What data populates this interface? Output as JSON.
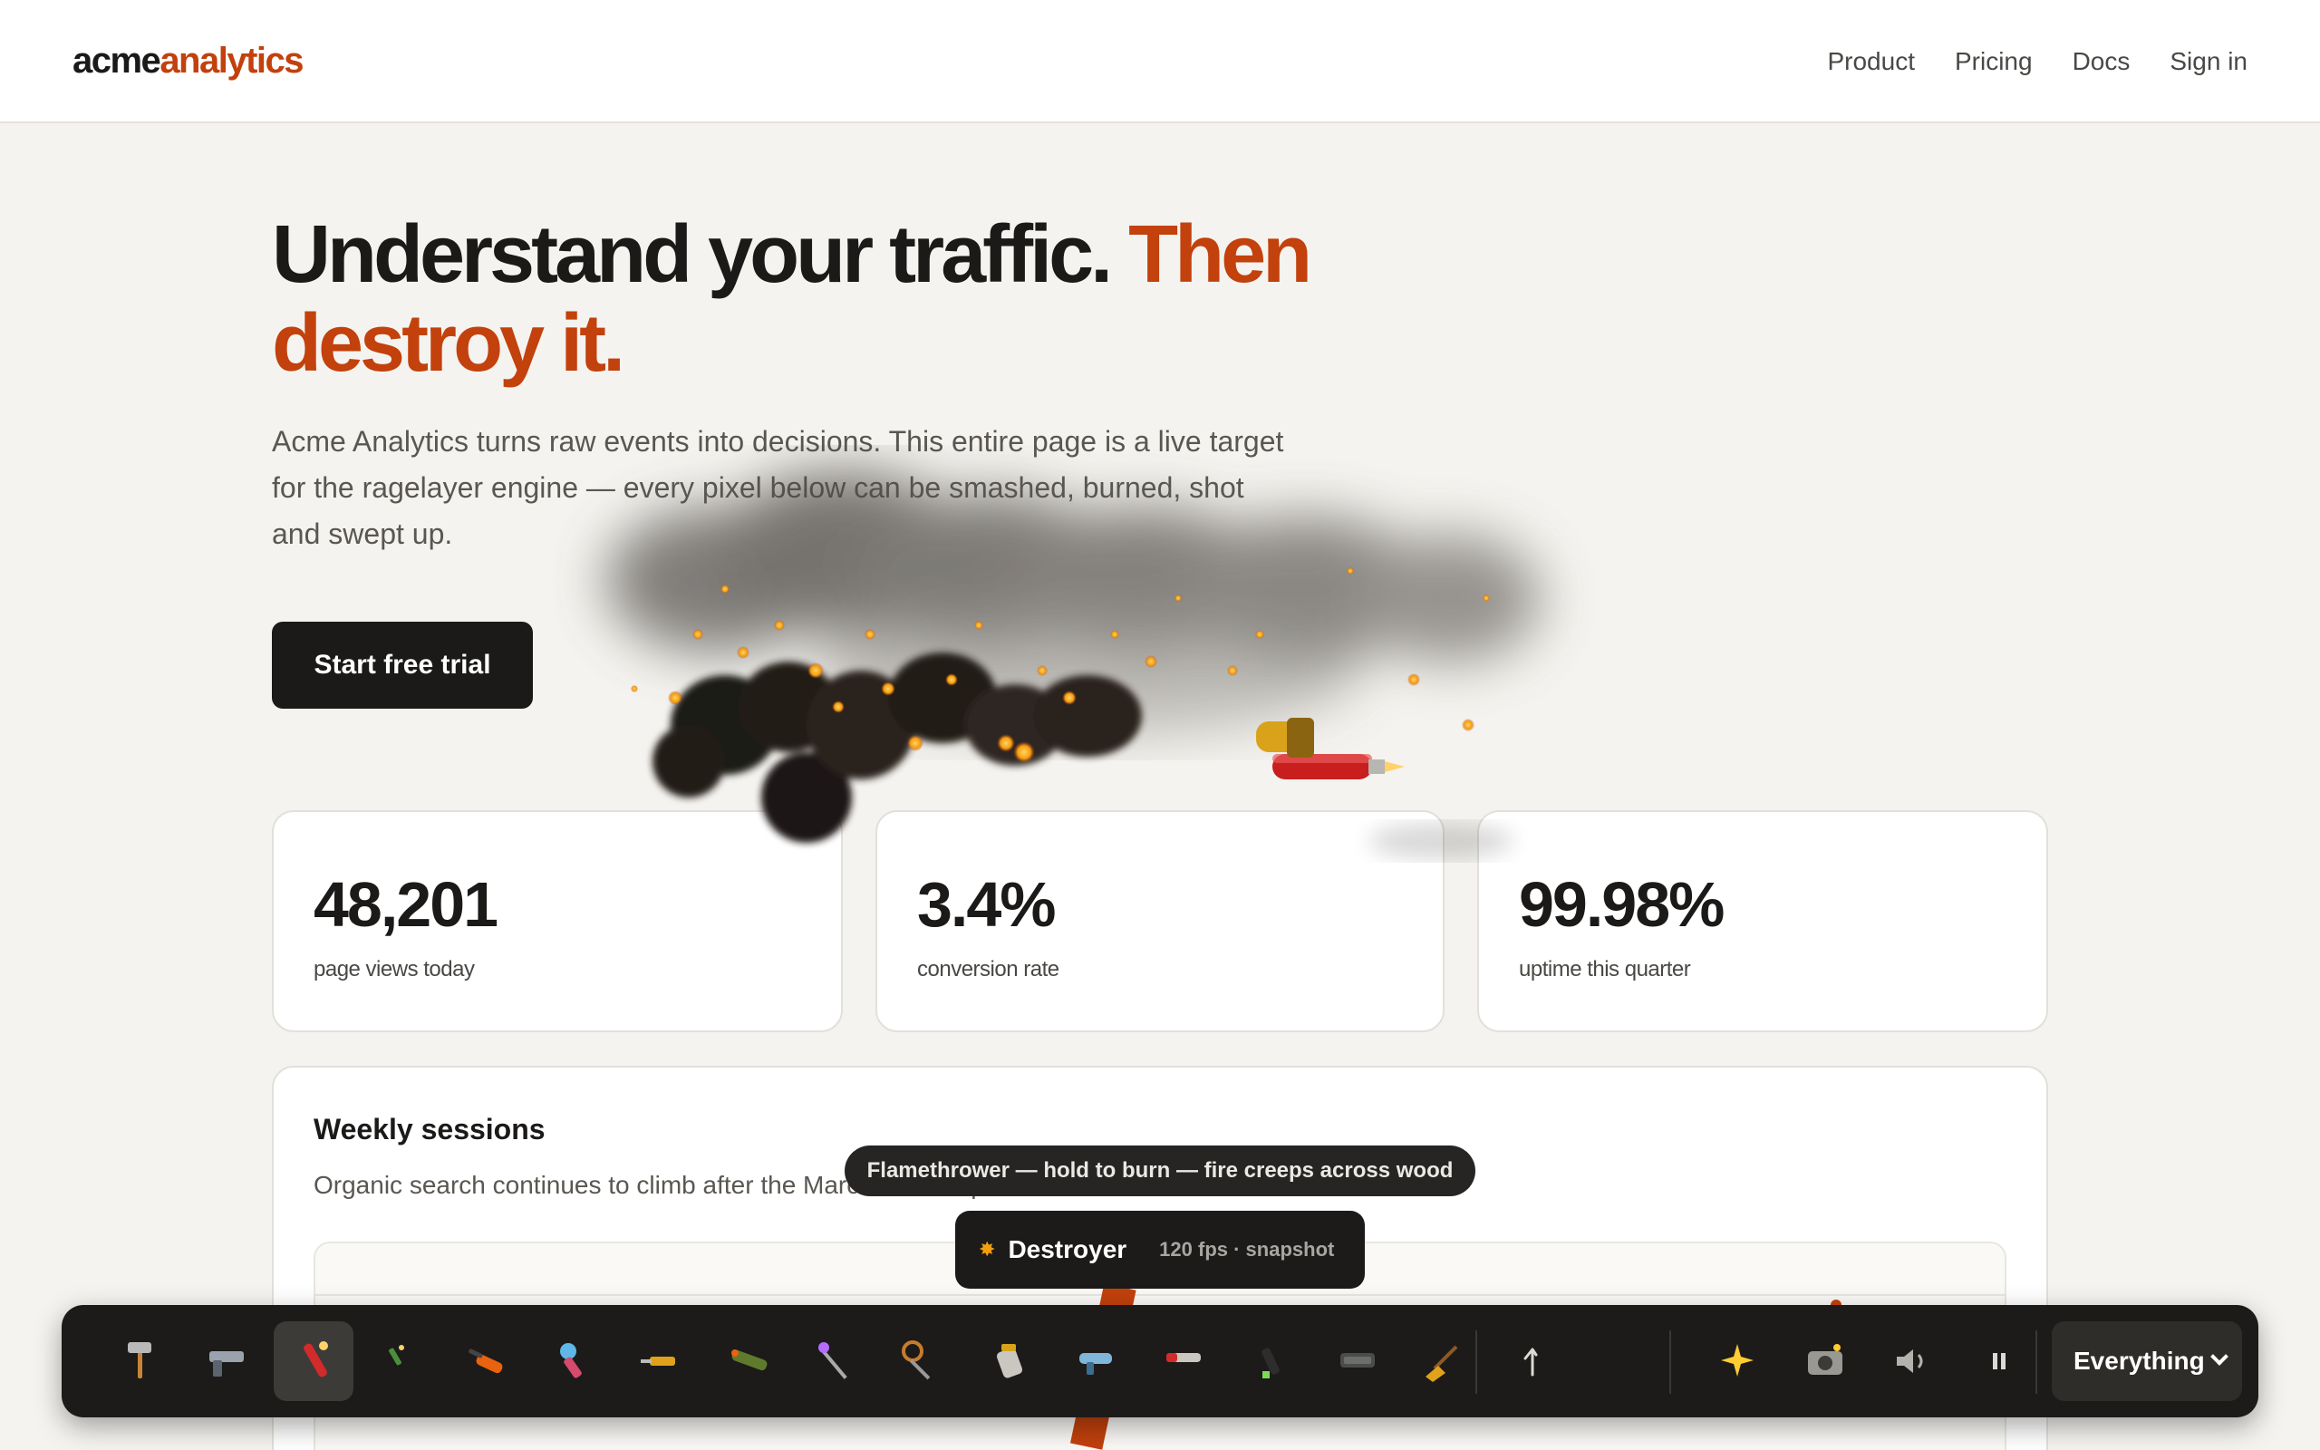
{
  "nav": {
    "logo_part1": "acme",
    "logo_part2": "analytics",
    "links": [
      "Product",
      "Pricing",
      "Docs",
      "Sign in"
    ]
  },
  "hero": {
    "title_main": "Understand your traffic.",
    "title_highlight": "Then destroy it.",
    "subtitle": "Acme Analytics turns raw events into decisions. This entire page is a live target for the ragelayer engine — every pixel below can be smashed, burned, shot and swept up.",
    "cta_label": "Start free trial"
  },
  "stats": [
    {
      "value": "48,201",
      "label": "page views today"
    },
    {
      "value": "3.4%",
      "label": "conversion rate"
    },
    {
      "value": "99.98%",
      "label": "uptime this quarter"
    }
  ],
  "panel": {
    "title": "Weekly sessions",
    "subtitle": "Organic search continues to climb after the March content push."
  },
  "tooltip": "Flamethrower — hold to burn — fire creeps across wood",
  "badge": {
    "icon": "explosion-icon",
    "name": "Destroyer",
    "fps": "120 fps · snapshot"
  },
  "toolbar": {
    "tools": [
      "hammer-icon",
      "gun-icon",
      "flamethrower-icon",
      "laser-icon",
      "chainsaw-icon",
      "bubble-gun-icon",
      "drill-icon",
      "rocket-launcher-icon",
      "wand-icon",
      "lollipop-icon",
      "paint-jar-icon",
      "blaster-icon",
      "flare-gun-icon",
      "marker-icon",
      "battery-icon",
      "broom-icon",
      "undo-icon",
      "sparkles-icon",
      "camera-icon",
      "speaker-icon",
      "pause-icon"
    ],
    "active_tool": "flamethrower-icon",
    "filter_value": "Everything"
  },
  "colors": {
    "accent": "#c2410c",
    "background": "#f4f3ef",
    "toolbar": "#1c1b19"
  }
}
